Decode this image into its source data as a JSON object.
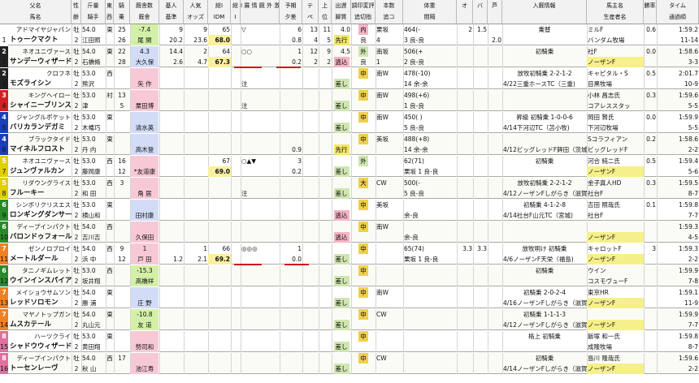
{
  "header": {
    "cols": [
      {
        "k": "sire",
        "l1": "父名",
        "l2": "馬名"
      },
      {
        "k": "sex",
        "l1": "性",
        "l2": "齢"
      },
      {
        "k": "wt",
        "l1": "斤量",
        "l2": "騎手"
      },
      {
        "k": "east",
        "l1": "東",
        "l2": "西"
      },
      {
        "k": "age",
        "l1": "騎",
        "l2": "乗"
      },
      {
        "k": "src",
        "l1": "厩舎数",
        "l2": "厩舎"
      },
      {
        "k": "base",
        "l1": "基人",
        "l2": "基準"
      },
      {
        "k": "pop",
        "l1": "人気",
        "l2": "オッズ"
      },
      {
        "k": "idm",
        "l1": "総I",
        "l2": "IDM"
      },
      {
        "k": "res",
        "l1": "総",
        "l2": "I"
      },
      {
        "k": "marks",
        "l1": "I 展 情 厩 外 激",
        "l2": ""
      },
      {
        "k": "pred",
        "l1": "予期",
        "l2": "夕差"
      },
      {
        "k": "te",
        "l1": "テ",
        "l2": "ペ"
      },
      {
        "k": "deg",
        "l1": "上",
        "l2": "位"
      },
      {
        "k": "start",
        "l1": "出遅",
        "l2": "脚質"
      },
      {
        "k": "exp",
        "l1": "調印変評",
        "l2": "追切指"
      },
      {
        "k": "cnt",
        "l1": "本数",
        "l2": "追コ"
      },
      {
        "k": "body",
        "l1": "体重",
        "l2": "間隔"
      },
      {
        "k": "o",
        "l1": "オ",
        "l2": ""
      },
      {
        "k": "ba",
        "l1": "バ",
        "l2": ""
      },
      {
        "k": "gai",
        "l1": "芦",
        "l2": ""
      },
      {
        "k": "entry",
        "l1": "入厩情報",
        "l2": ""
      },
      {
        "k": "owner",
        "l1": "馬主名",
        "l2": "生産者名"
      },
      {
        "k": "win",
        "l1": "勝率",
        "l2": ""
      },
      {
        "k": "time",
        "l1": "タイム",
        "l2": "通過順"
      }
    ]
  },
  "rows": [
    {
      "waku": "1",
      "wc": "#ffffff",
      "wt": "54.0",
      "num": "1",
      "sire": "アドマイヤジャパン",
      "name": "トゥークマクト",
      "sex": "牡",
      "age": "2",
      "jockey": "江田照",
      "ew": "東",
      "eb": "25",
      "ec": "26",
      "src": "9",
      "trainer": "尾 関",
      "bx": "-7.4",
      "bc": "b-green",
      "base": "20.2",
      "pop": "9",
      "odds": "23.6",
      "idm1": "65",
      "idm": "68.0",
      "marks1": "▽",
      "marks2": "",
      "pred": "6",
      "pred2": "0.8",
      "te": "13",
      "te2": "4",
      "deg": "11",
      "deg2": "5",
      "st": "4.0",
      "st2": "先行",
      "stc": "mid",
      "exp": "内",
      "exp2": "良",
      "cnt": "栗坂",
      "cnt2": "4",
      "body": "464(-",
      "body2": "3 良-良",
      "o": "2",
      "ba": "1.5",
      "gai": "2.0",
      "entry": "乗替",
      "entry2": "",
      "owner": "ミルF",
      "owner2": "バンダム牧場",
      "win": "0.6",
      "t1": "1:59.2",
      "t2": "11-14"
    },
    {
      "waku": "2",
      "wc": "#222222",
      "wt": "54.0",
      "num": "2",
      "sire": "ネオユニヴァース",
      "name": "サンデーウィザード",
      "sex": "牡",
      "age": "2",
      "jockey": "石橋脩",
      "ew": "東",
      "eb": "22",
      "ec": "28",
      "src": "14.4",
      "trainer": "大久保",
      "bx": "4.3",
      "bc": "b-blue",
      "base": "2.6",
      "pop": "2",
      "odds": "4.7",
      "idm1": "64",
      "idm": "67.3",
      "marks1": "○○",
      "marks2": "",
      "pred": "1",
      "pred2": "0.2",
      "te": "12",
      "te2": "2",
      "deg": "9",
      "deg2": "2",
      "st": "4.5",
      "st2": "逃込",
      "stc": "in",
      "exp": "外",
      "exp2": "良",
      "cnt": "南坂",
      "cnt2": "1",
      "body": "506(+",
      "body2": "2 良-良",
      "o": "",
      "ba": "",
      "gai": "",
      "entry": "初騎乗",
      "entry2": "",
      "owner": "社F",
      "owner2": "ノーザンF",
      "win": "0.0",
      "t1": "1:58.6",
      "t2": "3-3"
    },
    {
      "waku": "2",
      "wc": "#222222",
      "wt": "53.0",
      "num": "3",
      "sire": "クロフネ",
      "name": "モズライシン",
      "sex": "牡",
      "age": "2",
      "jockey": "熊沢",
      "ew": "西",
      "eb": "",
      "ec": "",
      "src": "",
      "trainer": "矢 作",
      "bx": "",
      "bc": "b-pink",
      "base": "",
      "pop": "",
      "odds": "",
      "idm1": "",
      "idm": "",
      "marks1": "",
      "marks2": "注",
      "pred": "",
      "pred2": "",
      "te": "",
      "te2": "",
      "deg": "",
      "deg2": "",
      "st": "",
      "st2": "差し",
      "stc": "out",
      "exp": "中",
      "exp2": "",
      "cnt": "南W",
      "cnt2": "",
      "body": "478(-10)",
      "body2": "14 余-余",
      "o": "",
      "ba": "",
      "gai": "",
      "entry": "放牧初騎乗  2-2-1-2",
      "entry2": "4/22三重ホースTC（三重)",
      "owner": "キャピタル・S",
      "owner2": "目黒牧場",
      "win": "0.5",
      "t1": "2:01.7",
      "t2": "10-9"
    },
    {
      "waku": "3",
      "wc": "#d02020",
      "wt": "53.0",
      "num": "4",
      "sire": "キングヘイロー",
      "name": "シャイニーブリンス",
      "sex": "牡",
      "age": "2",
      "jockey": "津",
      "ew": "村",
      "eb": "13",
      "ec": "5",
      "src": "",
      "trainer": "栗田博",
      "bx": "",
      "bc": "b-pink",
      "base": "",
      "pop": "",
      "odds": "",
      "idm1": "",
      "idm": "",
      "marks1": "",
      "marks2": "注",
      "pred": "",
      "pred2": "",
      "te": "",
      "te2": "",
      "deg": "",
      "deg2": "",
      "st": "",
      "st2": "差し",
      "stc": "out",
      "exp": "中",
      "exp2": "",
      "cnt": "南W",
      "cnt2": "",
      "body": "498(+6)",
      "body2": "1 良-良",
      "o": "",
      "ba": "",
      "gai": "",
      "entry": "",
      "entry2": "",
      "owner": "小林 昌志氏",
      "owner2": "コアレススタッ",
      "win": "0.3",
      "t1": "1:59.6",
      "t2": "5-5"
    },
    {
      "waku": "4",
      "wc": "#1a3db8",
      "wt": "53.0",
      "num": "5",
      "sire": "ジャングルポケット",
      "name": "バリカランデガミ",
      "sex": "牡",
      "age": "2",
      "jockey": "木幡巧",
      "ew": "東",
      "eb": "",
      "ec": "",
      "src": "",
      "trainer": "清水英",
      "bx": "",
      "bc": "b-blue",
      "base": "",
      "pop": "",
      "odds": "",
      "idm1": "",
      "idm": "",
      "marks1": "",
      "marks2": "",
      "pred": "",
      "pred2": "",
      "te": "",
      "te2": "",
      "deg": "",
      "deg2": "",
      "st": "",
      "st2": "差し",
      "stc": "out",
      "exp": "中",
      "exp2": "",
      "cnt": "南W",
      "cnt2": "",
      "body": "450(  )",
      "body2": "5 良-良",
      "o": "",
      "ba": "",
      "gai": "",
      "entry": "昇級  初騎乗  1-0-0-6",
      "entry2": "4/14下河辺TC（苫小牧)",
      "owner": "岡田 賢氏",
      "owner2": "下河辺牧場",
      "win": "0.0",
      "t1": "1:59.9",
      "t2": "5-5"
    },
    {
      "waku": "4",
      "wc": "#1a3db8",
      "wt": "53.0",
      "num": "6",
      "sire": "ブラックタイド",
      "name": "マイネルフロスト",
      "sex": "牡",
      "age": "2",
      "jockey": "丹 内",
      "ew": "東",
      "eb": "",
      "ec": "",
      "src": "",
      "trainer": "高木登",
      "bx": "",
      "bc": "b-blue",
      "base": "",
      "pop": "",
      "odds": "",
      "idm1": "",
      "idm": "",
      "marks1": "",
      "marks2": "",
      "pred": "",
      "pred2": "0.9",
      "te": "",
      "te2": "",
      "deg": "",
      "deg2": "",
      "st": "",
      "st2": "先行",
      "stc": "mid",
      "exp": "中",
      "exp2": "",
      "cnt": "美坂",
      "cnt2": "",
      "body": "488(+8)",
      "body2": "14 余-余",
      "o": "",
      "ba": "",
      "gai": "",
      "entry": "",
      "entry2": "4/12ビッグレッドF鉾田（茨城)",
      "owner": "Sコラフィアン",
      "owner2": "ビッグレッドF",
      "win": "0.2",
      "t1": "1:58.6",
      "t2": "2-2"
    },
    {
      "waku": "5",
      "wc": "#e0d000",
      "wt": "53.0",
      "num": "7",
      "sire": "ネオユニヴァース",
      "name": "ジュンヴァルカン",
      "sex": "牡",
      "age": "2",
      "jockey": "藤岡康",
      "ew": "西",
      "eb": "16",
      "ec": "12",
      "src": "",
      "trainer": "*友道康",
      "bx": "",
      "bc": "b-pink",
      "base": "",
      "pop": "",
      "odds": "",
      "idm1": "67",
      "idm": "69.0",
      "marks1": "○▲▼",
      "marks2": "",
      "pred": "3",
      "pred2": "0.2",
      "te": "",
      "te2": "",
      "deg": "",
      "deg2": "",
      "st": "",
      "st2": "差し",
      "stc": "out",
      "exp": "外",
      "exp2": "",
      "cnt": "",
      "cnt2": "",
      "body": "62(71)",
      "body2": "栗坂 1 良-良",
      "o": "",
      "ba": "",
      "gai": "",
      "entry": "初騎乗",
      "entry2": "",
      "owner": "河合 純二氏",
      "owner2": "ノーザンF",
      "win": "0.5",
      "t1": "1:59.4",
      "t2": "5-6"
    },
    {
      "waku": "5",
      "wc": "#e0d000",
      "wt": "53.0",
      "num": "8",
      "sire": "リダウングライス",
      "name": "フルーキー",
      "sex": "牡",
      "age": "2",
      "jockey": "和 田",
      "ew": "西",
      "eb": "3",
      "ec": "",
      "src": "",
      "trainer": "角 居",
      "bx": "",
      "bc": "b-pink",
      "base": "",
      "pop": "",
      "odds": "",
      "idm1": "",
      "idm": "",
      "marks1": "",
      "marks2": "注",
      "pred": "",
      "pred2": "",
      "te": "",
      "te2": "",
      "deg": "",
      "deg2": "",
      "st": "",
      "st2": "差し",
      "stc": "out",
      "exp": "大",
      "exp2": "",
      "cnt": "CW",
      "cnt2": "",
      "body": "500(-",
      "body2": "5 良-良",
      "o": "",
      "ba": "",
      "gai": "",
      "entry": "放牧初騎乗  2-2-1-2",
      "entry2": "4/12ノーザンFしがらき（滋賀)",
      "owner": "金子真人HD",
      "owner2": "社台F",
      "win": "0.3",
      "t1": "1:59.5",
      "t2": "8-7"
    },
    {
      "waku": "6",
      "wc": "#2a8a2a",
      "wt": "53.0",
      "num": "9",
      "sire": "シンボリクリスエス",
      "name": "ロンギングダンサー",
      "sex": "牡",
      "age": "2",
      "jockey": "横山和",
      "ew": "東",
      "eb": "",
      "ec": "",
      "src": "",
      "trainer": "田村康",
      "bx": "",
      "bc": "b-blue",
      "base": "",
      "pop": "",
      "odds": "",
      "idm1": "",
      "idm": "",
      "marks1": "",
      "marks2": "",
      "pred": "",
      "pred2": "",
      "te": "",
      "te2": "",
      "deg": "",
      "deg2": "",
      "st": "",
      "st2": "逃込",
      "stc": "in",
      "exp": "中",
      "exp2": "",
      "cnt": "美坂",
      "cnt2": "",
      "body": "",
      "body2": "余-良",
      "o": "",
      "ba": "",
      "gai": "",
      "entry": "初騎乗  4-1-2-8",
      "entry2": "4/14社台F山元TC（宮城)",
      "owner": "吉田 照哉氏",
      "owner2": "社台F",
      "win": "0.1",
      "t1": "1:59.8",
      "t2": "7-7"
    },
    {
      "waku": "6",
      "wc": "#2a8a2a",
      "wt": "54.0",
      "num": "10",
      "sire": "ディープインパクト",
      "name": "バロンドゥフォール",
      "sex": "牡",
      "age": "2",
      "jockey": "吉川吉",
      "ew": "西",
      "eb": "",
      "ec": "",
      "src": "",
      "trainer": "久保田",
      "bx": "",
      "bc": "b-pink",
      "base": "",
      "pop": "",
      "odds": "",
      "idm1": "",
      "idm": "",
      "marks1": "",
      "marks2": "",
      "pred": "",
      "pred2": "",
      "te": "",
      "te2": "",
      "deg": "",
      "deg2": "",
      "st": "",
      "st2": "逃込",
      "stc": "in",
      "exp": "中",
      "exp2": "",
      "cnt": "南W",
      "cnt2": "",
      "body": "",
      "body2": "余-良",
      "o": "",
      "ba": "",
      "gai": "",
      "entry": "",
      "entry2": "",
      "owner": "",
      "owner2": "ノーザンF",
      "win": "",
      "t1": "1:59.3",
      "t2": "4-5"
    },
    {
      "waku": "7",
      "wc": "#f08020",
      "wt": "54.0",
      "num": "11",
      "sire": "ゼンノロブロイ",
      "name": "メートルダール",
      "sex": "牡",
      "age": "2",
      "jockey": "浜 中",
      "ew": "西",
      "eb": "9",
      "ec": "12",
      "src": "",
      "trainer": "戸 田",
      "bx": "1",
      "bc": "b-pink",
      "base": "1.2",
      "pop": "1",
      "odds": "2.1",
      "idm1": "66",
      "idm": "69.2",
      "marks1": "◎◎◎",
      "marks2": "",
      "pred": "1",
      "pred2": "0.0",
      "te": "",
      "te2": "",
      "deg": "",
      "deg2": "",
      "st": "",
      "st2": "差し",
      "stc": "out",
      "exp": "中",
      "exp2": "",
      "cnt": "",
      "cnt2": "",
      "body": "65(74)",
      "body2": "栗坂 1 良-良",
      "o": "3.3",
      "ba": "3.3",
      "gai": "",
      "entry": "放牧明け  初騎乗",
      "entry2": "4/6ノーザンF天栄（福島)",
      "owner": "キャロットF",
      "owner2": "ノーザンF",
      "win": "3",
      "t1": "1:59.3",
      "t2": "2-2"
    },
    {
      "waku": "6",
      "wc": "#2a8a2a",
      "wt": "53.0",
      "num": "12",
      "sire": "タニノギムレット",
      "name": "ウインインスパイア",
      "sex": "牡",
      "age": "2",
      "jockey": "坂井翔",
      "ew": "西",
      "eb": "",
      "ec": "",
      "src": "",
      "trainer": "高橋祥",
      "bx": "-15.3",
      "bc": "b-green",
      "base": "",
      "pop": "",
      "odds": "",
      "idm1": "",
      "idm": "",
      "marks1": "",
      "marks2": "",
      "pred": "",
      "pred2": "",
      "te": "",
      "te2": "",
      "deg": "",
      "deg2": "",
      "st": "",
      "st2": "差し",
      "stc": "out",
      "exp": "中",
      "exp2": "",
      "cnt": "",
      "cnt2": "",
      "body": "",
      "body2": "",
      "o": "",
      "ba": "",
      "gai": "",
      "entry": "初騎乗",
      "entry2": "",
      "owner": "ウイン",
      "owner2": "コスモヴューF",
      "win": "",
      "t1": "1:59.9",
      "t2": "7-8"
    },
    {
      "waku": "7",
      "wc": "#f08020",
      "wt": "54.0",
      "num": "13",
      "sire": "メイショウサムソン",
      "name": "レッドソロモン",
      "sex": "牡",
      "age": "2",
      "jockey": "勝 浦",
      "ew": "東",
      "eb": "",
      "ec": "",
      "src": "",
      "trainer": "庄 野",
      "bx": "",
      "bc": "b-blue",
      "base": "",
      "pop": "",
      "odds": "",
      "idm1": "",
      "idm": "",
      "marks1": "",
      "marks2": "",
      "pred": "",
      "pred2": "",
      "te": "",
      "te2": "",
      "deg": "",
      "deg2": "",
      "st": "",
      "st2": "差し",
      "stc": "out",
      "exp": "中",
      "exp2": "",
      "cnt": "南W",
      "cnt2": "",
      "body": "",
      "body2": "",
      "o": "",
      "ba": "",
      "gai": "",
      "entry": "初騎乗  2-0-2-4",
      "entry2": "4/16ノーザンFしがらき（滋賀)",
      "owner": "東京HR",
      "owner2": "ノーザンF",
      "win": "",
      "t1": "1:59.1",
      "t2": "11-9"
    },
    {
      "waku": "7",
      "wc": "#f08020",
      "wt": "54.0",
      "num": "14",
      "sire": "マヤノトップガン",
      "name": "ムスカテール",
      "sex": "牡",
      "age": "2",
      "jockey": "丸山元",
      "ew": "東",
      "eb": "",
      "ec": "",
      "src": "",
      "trainer": "友 道",
      "bx": "-10.8",
      "bc": "b-green",
      "base": "",
      "pop": "",
      "odds": "",
      "idm1": "",
      "idm": "",
      "marks1": "",
      "marks2": "",
      "pred": "",
      "pred2": "",
      "te": "",
      "te2": "",
      "deg": "",
      "deg2": "",
      "st": "",
      "st2": "差し",
      "stc": "out",
      "exp": "中",
      "exp2": "",
      "cnt": "CW",
      "cnt2": "",
      "body": "",
      "body2": "",
      "o": "",
      "ba": "",
      "gai": "",
      "entry": "初騎乗  1-1-1-3",
      "entry2": "4/12ノーザンFしがらき（滋賀)",
      "owner": "",
      "owner2": "ノーザンF",
      "win": "",
      "t1": "1:59.9",
      "t2": "7-7"
    },
    {
      "waku": "8",
      "wc": "#e070a0",
      "wt": "53.0",
      "num": "15",
      "sire": "ハーツクライ",
      "name": "シャドウウィザード",
      "sex": "牡",
      "age": "2",
      "jockey": "黄田翔",
      "ew": "東",
      "eb": "",
      "ec": "",
      "src": "",
      "trainer": "勢司和",
      "bx": "",
      "bc": "b-pink",
      "base": "",
      "pop": "",
      "odds": "",
      "idm1": "",
      "idm": "",
      "marks1": "",
      "marks2": "",
      "pred": "",
      "pred2": "",
      "te": "",
      "te2": "",
      "deg": "",
      "deg2": "",
      "st": "",
      "st2": "差し",
      "stc": "out",
      "exp": "中",
      "exp2": "",
      "cnt": "",
      "cnt2": "",
      "body": "",
      "body2": "",
      "o": "",
      "ba": "",
      "gai": "",
      "entry": "格上  初騎乗",
      "entry2": "",
      "owner": "飯塚 和一氏",
      "owner2": "成隆牧場",
      "win": "",
      "t1": "1:59.8",
      "t2": "8-7"
    },
    {
      "waku": "8",
      "wc": "#e070a0",
      "wt": "54.0",
      "num": "16",
      "sire": "ディープインパクト",
      "name": "トーセンレーヴ",
      "sex": "牡",
      "age": "2",
      "jockey": "秋 山",
      "ew": "西",
      "eb": "17",
      "ec": "",
      "src": "",
      "trainer": "池江寿",
      "bx": "",
      "bc": "b-pink",
      "base": "",
      "pop": "",
      "odds": "",
      "idm1": "",
      "idm": "",
      "marks1": "",
      "marks2": "",
      "pred": "",
      "pred2": "",
      "te": "",
      "te2": "",
      "deg": "",
      "deg2": "",
      "st": "",
      "st2": "差し",
      "stc": "out",
      "exp": "中",
      "exp2": "",
      "cnt": "CW",
      "cnt2": "",
      "body": "",
      "body2": "",
      "o": "",
      "ba": "",
      "gai": "",
      "entry": "初騎乗",
      "entry2": "4/14ノーザンFしがらき（滋賀)",
      "owner": "島川 隆哉氏",
      "owner2": "ノーザンF",
      "win": "",
      "t1": "1:59.6",
      "t2": "2-2"
    }
  ]
}
